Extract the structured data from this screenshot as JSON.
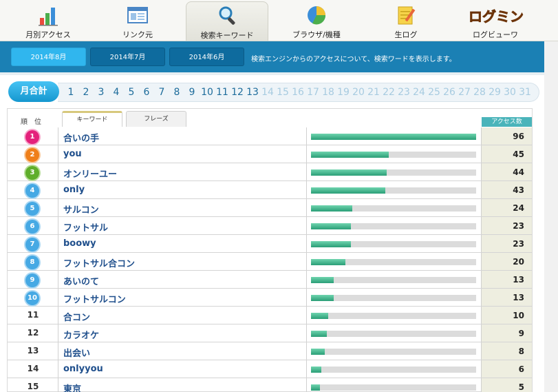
{
  "top_nav": [
    {
      "label": "月別アクセス",
      "icon": "bar-chart-icon"
    },
    {
      "label": "リンク元",
      "icon": "window-icon"
    },
    {
      "label": "検索キーワード",
      "icon": "magnifier-icon"
    },
    {
      "label": "ブラウザ/機種",
      "icon": "pie-chart-icon"
    },
    {
      "label": "生ログ",
      "icon": "notepad-pencil-icon"
    },
    {
      "label": "ログビューワ",
      "icon": "logo-icon"
    }
  ],
  "logo_text": "ログミン",
  "month_tabs": [
    "2014年8月",
    "2014年7月",
    "2014年6月"
  ],
  "subbar_description": "検索エンジンからのアクセスについて、検索ワードを表示します。",
  "monthly_total_label": "月合計",
  "days": [
    "1",
    "2",
    "3",
    "4",
    "5",
    "6",
    "7",
    "8",
    "9",
    "10",
    "11",
    "12",
    "13",
    "14",
    "15",
    "16",
    "17",
    "18",
    "19",
    "20",
    "21",
    "22",
    "23",
    "24",
    "25",
    "26",
    "27",
    "28",
    "29",
    "30",
    "31"
  ],
  "active_day_count": 13,
  "table": {
    "rank_header": "順　位",
    "tabs": [
      "キーワード",
      "フレーズ"
    ],
    "access_header": "アクセス数",
    "max_count": 96,
    "rows": [
      {
        "rank": "1",
        "keyword": "合いの手",
        "count": "96",
        "badge": "pink"
      },
      {
        "rank": "2",
        "keyword": "you",
        "count": "45",
        "badge": "orange"
      },
      {
        "rank": "3",
        "keyword": "オンリーユー",
        "count": "44",
        "badge": "green"
      },
      {
        "rank": "4",
        "keyword": "only",
        "count": "43",
        "badge": "blue"
      },
      {
        "rank": "5",
        "keyword": "サルコン",
        "count": "24",
        "badge": "blue"
      },
      {
        "rank": "6",
        "keyword": "フットサル",
        "count": "23",
        "badge": "blue"
      },
      {
        "rank": "7",
        "keyword": "boowy",
        "count": "23",
        "badge": "blue"
      },
      {
        "rank": "8",
        "keyword": "フットサル合コン",
        "count": "20",
        "badge": "blue"
      },
      {
        "rank": "9",
        "keyword": "あいのて",
        "count": "13",
        "badge": "blue"
      },
      {
        "rank": "10",
        "keyword": "フットサルコン",
        "count": "13",
        "badge": "blue"
      },
      {
        "rank": "11",
        "keyword": "合コン",
        "count": "10",
        "badge": ""
      },
      {
        "rank": "12",
        "keyword": "カラオケ",
        "count": "9",
        "badge": ""
      },
      {
        "rank": "13",
        "keyword": "出会い",
        "count": "8",
        "badge": ""
      },
      {
        "rank": "14",
        "keyword": "onlyyou",
        "count": "6",
        "badge": ""
      },
      {
        "rank": "15",
        "keyword": "東京",
        "count": "5",
        "badge": ""
      }
    ]
  },
  "colors": {
    "subbar": "#1b80b4",
    "active_tab": "#30b6ee",
    "bar_fill": "#2a9e77",
    "count_column": "#eeeee0"
  }
}
